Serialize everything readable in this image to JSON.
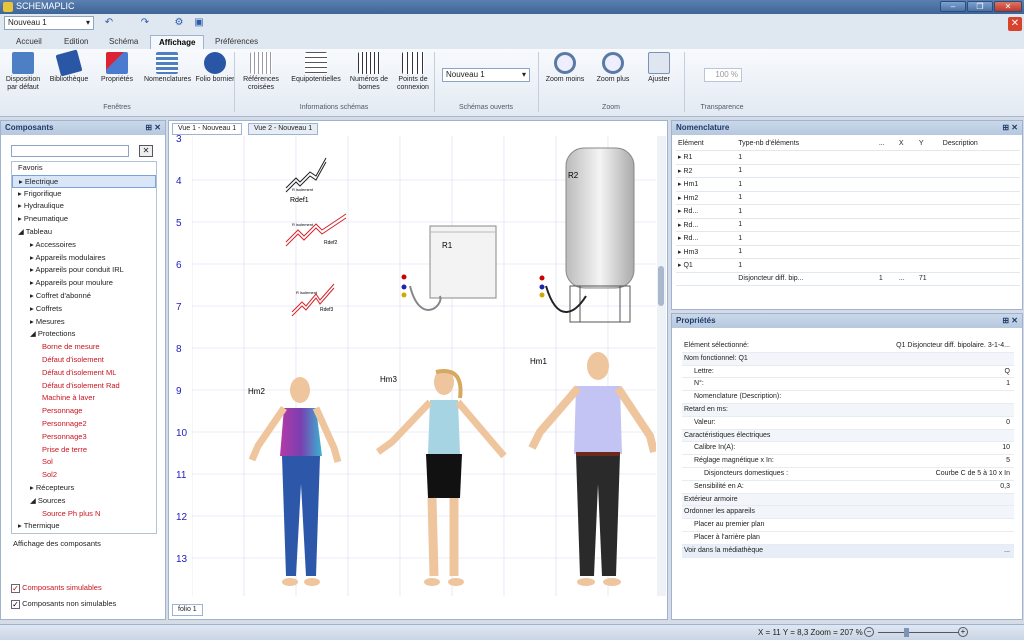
{
  "app": {
    "title": "SCHEMAPLIC"
  },
  "quickbar": {
    "project": "Nouveau 1"
  },
  "menu_tabs": [
    "Accueil",
    "Edition",
    "Schéma",
    "Affichage",
    "Préférences"
  ],
  "ribbon": {
    "buttons": [
      "Disposition par défaut",
      "Bibliothèque",
      "Propriétés",
      "Nomenclatures",
      "Folio bornier",
      "Références croisées",
      "Equipotentielles",
      "Numéros de bornes",
      "Points de connexion",
      "Zoom moins",
      "Zoom plus",
      "Ajuster"
    ],
    "groups": [
      "Fenêtres",
      "Informations schémas",
      "Schémas ouverts",
      "Zoom",
      "Transparence"
    ],
    "open_schema": "Nouveau 1",
    "transparency": "100 %"
  },
  "components": {
    "title": "Composants",
    "tree": [
      {
        "label": "Favoris",
        "level": 0,
        "red": false
      },
      {
        "label": "Electrique",
        "level": 0,
        "red": false
      },
      {
        "label": "Frigorifique",
        "level": 0,
        "red": false
      },
      {
        "label": "Hydraulique",
        "level": 0,
        "red": false
      },
      {
        "label": "Pneumatique",
        "level": 0,
        "red": false
      },
      {
        "label": "Tableau",
        "level": 0,
        "red": false
      },
      {
        "label": "Accessoires",
        "level": 1,
        "red": false
      },
      {
        "label": "Appareils modulaires",
        "level": 1,
        "red": false
      },
      {
        "label": "Appareils pour conduit IRL",
        "level": 1,
        "red": false
      },
      {
        "label": "Appareils pour moulure",
        "level": 1,
        "red": false
      },
      {
        "label": "Coffret d'abonné",
        "level": 1,
        "red": false
      },
      {
        "label": "Coffrets",
        "level": 1,
        "red": false
      },
      {
        "label": "Mesures",
        "level": 1,
        "red": false
      },
      {
        "label": "Protections",
        "level": 1,
        "red": false
      },
      {
        "label": "Borne de mesure",
        "level": 2,
        "red": true
      },
      {
        "label": "Défaut d'isolement",
        "level": 2,
        "red": true
      },
      {
        "label": "Défaut d'isolement ML",
        "level": 2,
        "red": true
      },
      {
        "label": "Défaut d'isolement Rad",
        "level": 2,
        "red": true
      },
      {
        "label": "Machine à laver",
        "level": 2,
        "red": true
      },
      {
        "label": "Personnage",
        "level": 2,
        "red": true
      },
      {
        "label": "Personnage2",
        "level": 2,
        "red": true
      },
      {
        "label": "Personnage3",
        "level": 2,
        "red": true
      },
      {
        "label": "Prise de terre",
        "level": 2,
        "red": true
      },
      {
        "label": "Sol",
        "level": 2,
        "red": true
      },
      {
        "label": "Sol2",
        "level": 2,
        "red": true
      },
      {
        "label": "Récepteurs",
        "level": 1,
        "red": false
      },
      {
        "label": "Sources",
        "level": 1,
        "red": false
      },
      {
        "label": "Source Ph plus N",
        "level": 2,
        "red": true
      },
      {
        "label": "Thermique",
        "level": 0,
        "red": false
      }
    ],
    "display_label": "Affichage des composants",
    "simulable": "Composants simulables",
    "non_simulable": "Composants non simulables"
  },
  "doc": {
    "tabs": [
      "Vue 1 - Nouveau 1",
      "Vue 2 - Nouveau 1"
    ],
    "folio": "folio 1",
    "row_numbers": [
      "3",
      "4",
      "5",
      "6",
      "7",
      "8",
      "9",
      "10",
      "11",
      "12",
      "13"
    ],
    "labels": {
      "rdef1": "Rdef1",
      "rdef2": "Rdef2",
      "rdef3": "Rdef3",
      "r_isolement": "R isolement",
      "r1": "R1",
      "r2": "R2",
      "hm1": "Hm1",
      "hm2": "Hm2",
      "hm3": "Hm3"
    }
  },
  "nomenclature": {
    "title": "Nomenclature",
    "headers": [
      "Elément",
      "Type-nb d'éléments",
      "...",
      "X",
      "Y",
      "Description"
    ],
    "rows": [
      [
        "R1",
        "1"
      ],
      [
        "R2",
        "1"
      ],
      [
        "Hm1",
        "1"
      ],
      [
        "Hm2",
        "1"
      ],
      [
        "Rd...",
        "1"
      ],
      [
        "Rd...",
        "1"
      ],
      [
        "Rd...",
        "1"
      ],
      [
        "Hm3",
        "1"
      ],
      [
        "Q1",
        "1"
      ]
    ],
    "subrow": {
      "name": "Disjoncteur diff. bip...",
      "c1": "1",
      "c2": "...",
      "c3": "71"
    }
  },
  "properties": {
    "title": "Propriétés",
    "rows": [
      {
        "k": "Elément sélectionné:",
        "v": "Q1 Disjoncteur diff. bipolaire. 3-1-4...",
        "cat": false,
        "indent": 0
      },
      {
        "k": "Nom fonctionnel:        Q1",
        "v": "",
        "cat": true,
        "indent": 0
      },
      {
        "k": "Lettre:",
        "v": "Q",
        "cat": false,
        "indent": 1
      },
      {
        "k": "N°:",
        "v": "1",
        "cat": false,
        "indent": 1
      },
      {
        "k": "Nomenclature (Description):",
        "v": "",
        "cat": false,
        "indent": 1
      },
      {
        "k": "Retard en ms:",
        "v": "",
        "cat": true,
        "indent": 0
      },
      {
        "k": "Valeur:",
        "v": "0",
        "cat": false,
        "indent": 1
      },
      {
        "k": "Caractéristiques électriques",
        "v": "",
        "cat": true,
        "indent": 0
      },
      {
        "k": "Calibre In(A):",
        "v": "10",
        "cat": false,
        "indent": 1
      },
      {
        "k": "Réglage magnétique x In:",
        "v": "5",
        "cat": false,
        "indent": 1
      },
      {
        "k": "Disjoncteurs domestiques :",
        "v": "Courbe C de 5 à 10 x In",
        "cat": false,
        "indent": 2
      },
      {
        "k": "Sensibilité en A:",
        "v": "0,3",
        "cat": false,
        "indent": 1
      },
      {
        "k": "Extérieur armoire",
        "v": "",
        "cat": true,
        "indent": 0
      },
      {
        "k": "Ordonner les appareils",
        "v": "",
        "cat": true,
        "indent": 0
      },
      {
        "k": "Placer au premier plan",
        "v": "",
        "cat": false,
        "indent": 1
      },
      {
        "k": "Placer à l'arrière plan",
        "v": "",
        "cat": false,
        "indent": 1
      },
      {
        "k": "Voir dans la médiathèque",
        "v": "...",
        "cat": false,
        "indent": 0
      }
    ]
  },
  "status": {
    "coords": "X = 11 Y = 8,3 Zoom = 207 %"
  }
}
